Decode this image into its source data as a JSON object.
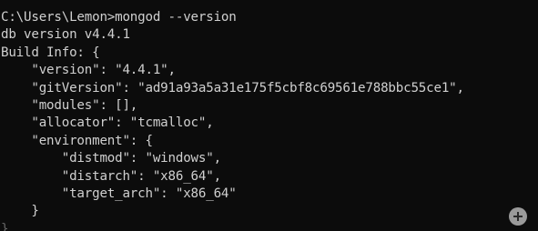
{
  "terminal": {
    "lines": [
      "C:\\Users\\Lemon>mongod --version",
      "db version v4.4.1",
      "Build Info: {",
      "    \"version\": \"4.4.1\",",
      "    \"gitVersion\": \"ad91a93a5a31e175f5cbf8c69561e788bbc55ce1\",",
      "    \"modules\": [],",
      "    \"allocator\": \"tcmalloc\",",
      "    \"environment\": {",
      "        \"distmod\": \"windows\",",
      "        \"distarch\": \"x86_64\",",
      "        \"target_arch\": \"x86_64\"",
      "    }",
      "}"
    ]
  },
  "overlay": {
    "icon": "zoom-in-icon",
    "icon_color": "#9a9a9a"
  },
  "colors": {
    "background": "#0c0c0c",
    "text": "#d0d0d0"
  }
}
